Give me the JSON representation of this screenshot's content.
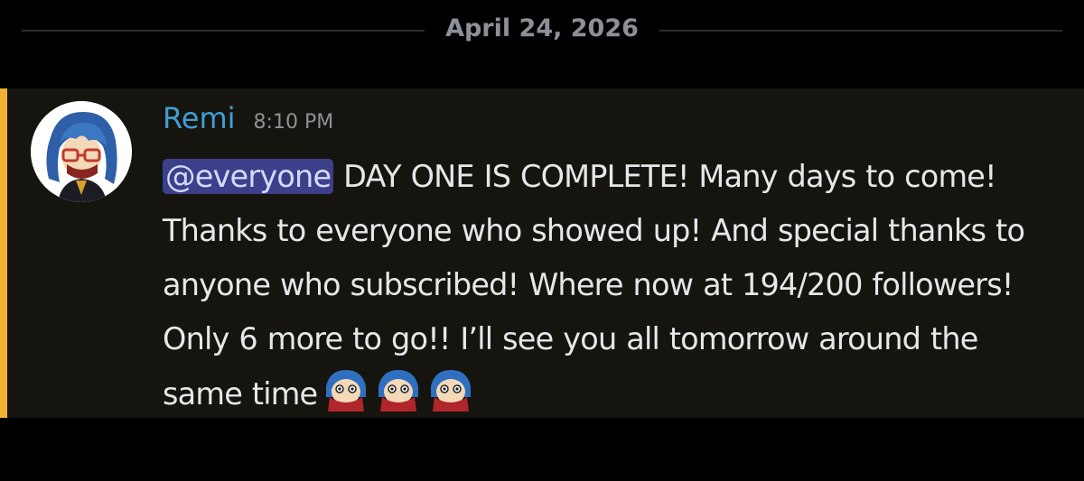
{
  "date_divider": {
    "label": "April 24, 2026"
  },
  "message": {
    "author": "Remi",
    "author_color": "#3d9fd6",
    "timestamp": "8:10 PM",
    "mention": "@everyone",
    "text_before_emoji": " DAY ONE IS COMPLETE! Many days to come! Thanks to everyone who showed up! And special thanks to anyone who subscribed! Where now at 194/200 followers! Only 6 more to go!! I’ll see you all tomorrow around the same time",
    "emojis": [
      "remi-peek-emoji",
      "remi-peek-emoji",
      "remi-peek-emoji"
    ],
    "highlight_color": "#f0b232",
    "avatar": "remi-avatar-icon"
  }
}
